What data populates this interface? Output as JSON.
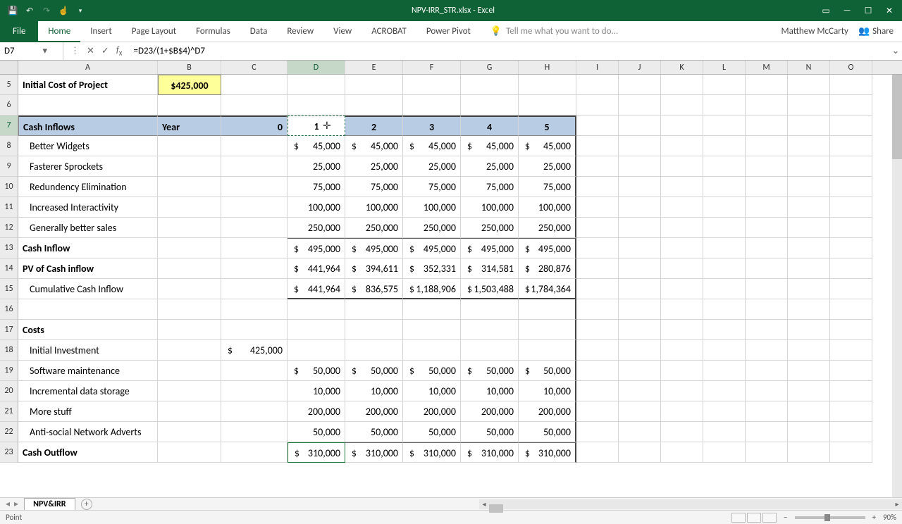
{
  "title": "NPV-IRR_STR.xlsx - Excel",
  "user": "Matthew McCarty",
  "share": "Share",
  "tell_me": "Tell me what you want to do...",
  "name_box": "D7",
  "formula": "=D23/(1+$B$4)^D7",
  "tabs": {
    "file": "File",
    "home": "Home",
    "insert": "Insert",
    "page_layout": "Page Layout",
    "formulas": "Formulas",
    "data": "Data",
    "review": "Review",
    "view": "View",
    "acrobat": "ACROBAT",
    "power_pivot": "Power Pivot"
  },
  "sheet_tab": "NPV&IRR",
  "status_mode": "Point",
  "zoom": "90%",
  "cols": [
    "A",
    "B",
    "C",
    "D",
    "E",
    "F",
    "G",
    "H",
    "I",
    "J",
    "K",
    "L",
    "M",
    "N",
    "O"
  ],
  "rows": {
    "r5": {
      "n": "5",
      "a": "Initial Cost of Project",
      "b": "$425,000"
    },
    "r6": {
      "n": "6"
    },
    "r7": {
      "n": "7",
      "a": "Cash Inflows",
      "b": "Year",
      "c": "0",
      "d": "1",
      "e": "2",
      "f": "3",
      "g": "4",
      "h": "5"
    },
    "r8": {
      "n": "8",
      "a": "Better Widgets",
      "vals": [
        "45,000",
        "45,000",
        "45,000",
        "45,000",
        "45,000"
      ],
      "dollar": true
    },
    "r9": {
      "n": "9",
      "a": "Fasterer Sprockets",
      "vals": [
        "25,000",
        "25,000",
        "25,000",
        "25,000",
        "25,000"
      ]
    },
    "r10": {
      "n": "10",
      "a": "Redundency Elimination",
      "vals": [
        "75,000",
        "75,000",
        "75,000",
        "75,000",
        "75,000"
      ]
    },
    "r11": {
      "n": "11",
      "a": "Increased Interactivity",
      "vals": [
        "100,000",
        "100,000",
        "100,000",
        "100,000",
        "100,000"
      ]
    },
    "r12": {
      "n": "12",
      "a": "Generally better sales",
      "vals": [
        "250,000",
        "250,000",
        "250,000",
        "250,000",
        "250,000"
      ]
    },
    "r13": {
      "n": "13",
      "a": "Cash Inflow",
      "vals": [
        "495,000",
        "495,000",
        "495,000",
        "495,000",
        "495,000"
      ],
      "dollar": true
    },
    "r14": {
      "n": "14",
      "a": "PV of Cash inflow",
      "vals": [
        "441,964",
        "394,611",
        "352,331",
        "314,581",
        "280,876"
      ],
      "dollar": true
    },
    "r15": {
      "n": "15",
      "a": "Cumulative Cash Inflow",
      "vals": [
        "441,964",
        "836,575",
        "1,188,906",
        "1,503,488",
        "1,784,364"
      ],
      "dollar": true,
      "dollar_all": true
    },
    "r16": {
      "n": "16"
    },
    "r17": {
      "n": "17",
      "a": "Costs"
    },
    "r18": {
      "n": "18",
      "a": "Initial Investment",
      "c": "425,000",
      "c_dollar": true
    },
    "r19": {
      "n": "19",
      "a": "Software maintenance",
      "vals": [
        "50,000",
        "50,000",
        "50,000",
        "50,000",
        "50,000"
      ],
      "dollar": true
    },
    "r20": {
      "n": "20",
      "a": "Incremental data storage",
      "vals": [
        "10,000",
        "10,000",
        "10,000",
        "10,000",
        "10,000"
      ]
    },
    "r21": {
      "n": "21",
      "a": "More stuff",
      "vals": [
        "200,000",
        "200,000",
        "200,000",
        "200,000",
        "200,000"
      ]
    },
    "r22": {
      "n": "22",
      "a": "Anti-social Network Adverts",
      "vals": [
        "50,000",
        "50,000",
        "50,000",
        "50,000",
        "50,000"
      ]
    },
    "r23": {
      "n": "23",
      "a": "Cash Outflow",
      "vals": [
        "310,000",
        "310,000",
        "310,000",
        "310,000",
        "310,000"
      ],
      "dollar": true
    }
  }
}
